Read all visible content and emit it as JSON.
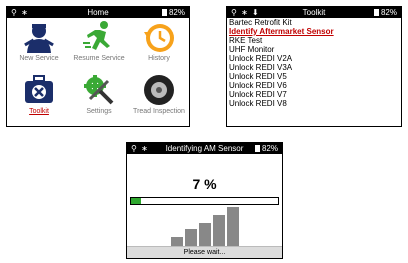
{
  "home": {
    "status_title": "Home",
    "battery": "82%",
    "tiles": [
      {
        "label": "New Service",
        "icon": "technician-icon"
      },
      {
        "label": "Resume Service",
        "icon": "running-man-icon"
      },
      {
        "label": "History",
        "icon": "history-clock-icon"
      },
      {
        "label": "Toolkit",
        "icon": "toolkit-case-icon",
        "selected": true
      },
      {
        "label": "Settings",
        "icon": "settings-tools-icon"
      },
      {
        "label": "Tread Inspection",
        "icon": "tire-icon"
      }
    ]
  },
  "toolkit": {
    "status_title": "Toolkit",
    "battery": "82%",
    "items": [
      "Bartec Retrofit Kit",
      "Identify Aftermarket Sensor",
      "RKE Test",
      "UHF Monitor",
      "Unlock REDI V2A",
      "Unlock REDI V3A",
      "Unlock REDI V5",
      "Unlock REDI V6",
      "Unlock REDI V7",
      "Unlock REDI V8"
    ],
    "selected_index": 1
  },
  "identify": {
    "status_title": "Identifying AM Sensor",
    "battery": "82%",
    "percent_label": "7 %",
    "progress": 0.07,
    "footer": "Please wait..."
  },
  "colors": {
    "highlight": "#c00000",
    "progress_fill": "#2fa82f",
    "signal_bars": "#888888"
  }
}
